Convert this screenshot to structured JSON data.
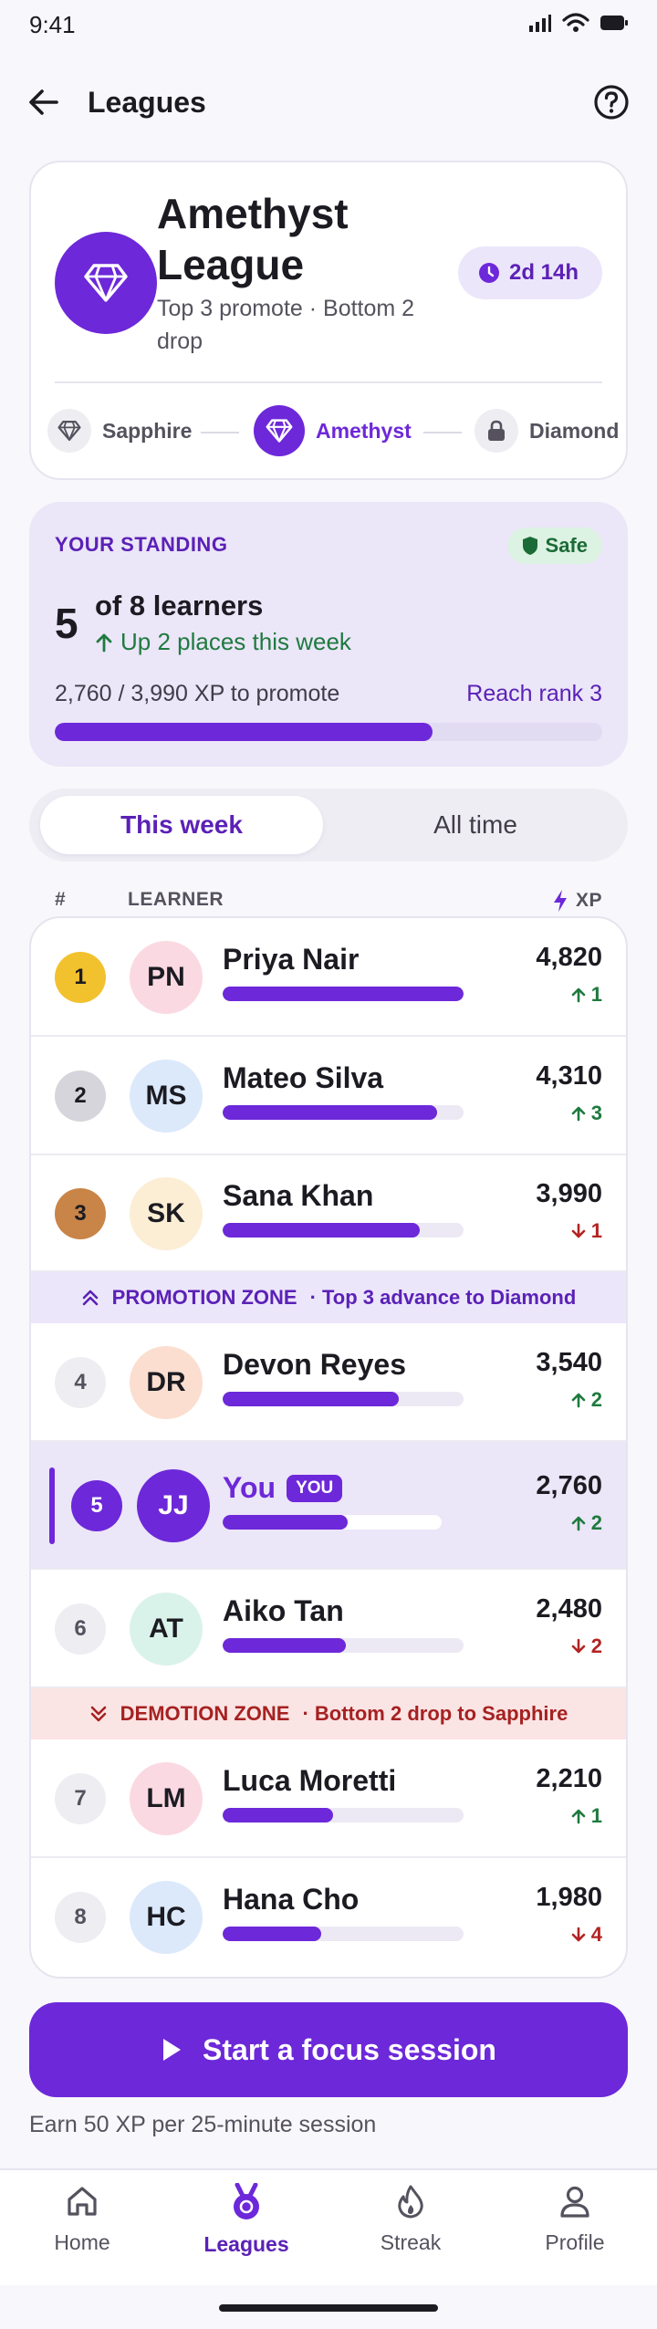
{
  "status_bar": {
    "time": "9:41"
  },
  "app_bar": {
    "title": "Leagues"
  },
  "league": {
    "name": "Amethyst League",
    "rule": "Top 3 promote · Bottom 2 drop",
    "time_left": "2d 14h",
    "tiers": [
      {
        "label": "Sapphire",
        "state": "previous",
        "icon": "gem-icon"
      },
      {
        "label": "Amethyst",
        "state": "current",
        "icon": "gem-icon"
      },
      {
        "label": "Diamond",
        "state": "locked",
        "icon": "lock-icon"
      }
    ]
  },
  "standing": {
    "label": "YOUR STANDING",
    "status": "Safe",
    "rank": "5",
    "of_text": "of 8 learners",
    "change_text": "Up 2 places this week",
    "xp_text": "2,760 / 3,990 XP to promote",
    "goal_link": "Reach rank 3",
    "progress": 0.69
  },
  "period_tabs": [
    {
      "label": "This week",
      "active": true
    },
    {
      "label": "All time",
      "active": false
    }
  ],
  "columns": {
    "rank": "#",
    "learner": "LEARNER",
    "xp": "XP"
  },
  "leaderboard": [
    {
      "rank": "1",
      "initials": "PN",
      "name": "Priya Nair",
      "xp": "4,820",
      "delta": "1",
      "direction": "up",
      "progress": 1.0,
      "avatar_color": "#fbd9e2",
      "rank_style": "gold"
    },
    {
      "rank": "2",
      "initials": "MS",
      "name": "Mateo Silva",
      "xp": "4,310",
      "delta": "3",
      "direction": "up",
      "progress": 0.89,
      "avatar_color": "#dbe9fb",
      "rank_style": "silver"
    },
    {
      "rank": "3",
      "initials": "SK",
      "name": "Sana Khan",
      "xp": "3,990",
      "delta": "1",
      "direction": "down",
      "progress": 0.82,
      "avatar_color": "#fbeed4",
      "rank_style": "bronze"
    },
    {
      "rank": "4",
      "initials": "DR",
      "name": "Devon Reyes",
      "xp": "3,540",
      "delta": "2",
      "direction": "up",
      "progress": 0.73,
      "avatar_color": "#fbdecf",
      "rank_style": "plain"
    },
    {
      "rank": "5",
      "initials": "JJ",
      "name": "You",
      "tag": "YOU",
      "xp": "2,760",
      "delta": "2",
      "direction": "up",
      "progress": 0.57,
      "avatar_color": "#6d28d9",
      "rank_style": "you"
    },
    {
      "rank": "6",
      "initials": "AT",
      "name": "Aiko Tan",
      "xp": "2,480",
      "delta": "2",
      "direction": "down",
      "progress": 0.51,
      "avatar_color": "#daf3ea",
      "rank_style": "plain"
    },
    {
      "rank": "7",
      "initials": "LM",
      "name": "Luca Moretti",
      "xp": "2,210",
      "delta": "1",
      "direction": "up",
      "progress": 0.46,
      "avatar_color": "#fbd9e2",
      "rank_style": "plain"
    },
    {
      "rank": "8",
      "initials": "HC",
      "name": "Hana Cho",
      "xp": "1,980",
      "delta": "4",
      "direction": "down",
      "progress": 0.41,
      "avatar_color": "#dbe9fb",
      "rank_style": "plain"
    }
  ],
  "zones": {
    "promotion": {
      "title": "PROMOTION ZONE",
      "desc": "· Top 3 advance to Diamond"
    },
    "demotion": {
      "title": "DEMOTION ZONE",
      "desc": "· Bottom 2 drop to Sapphire"
    }
  },
  "cta": {
    "label": "Start a focus session",
    "note": "Earn 50 XP per 25-minute session"
  },
  "tab_bar": [
    {
      "label": "Home",
      "icon": "home-icon",
      "active": false
    },
    {
      "label": "Leagues",
      "icon": "medal-icon",
      "active": true
    },
    {
      "label": "Streak",
      "icon": "flame-icon",
      "active": false
    },
    {
      "label": "Profile",
      "icon": "person-icon",
      "active": false
    }
  ],
  "colors": {
    "accent": "#6d28d9",
    "success": "#1f7a3f",
    "danger": "#b42323",
    "gold": "#f2c12e",
    "bronze": "#c98447"
  }
}
